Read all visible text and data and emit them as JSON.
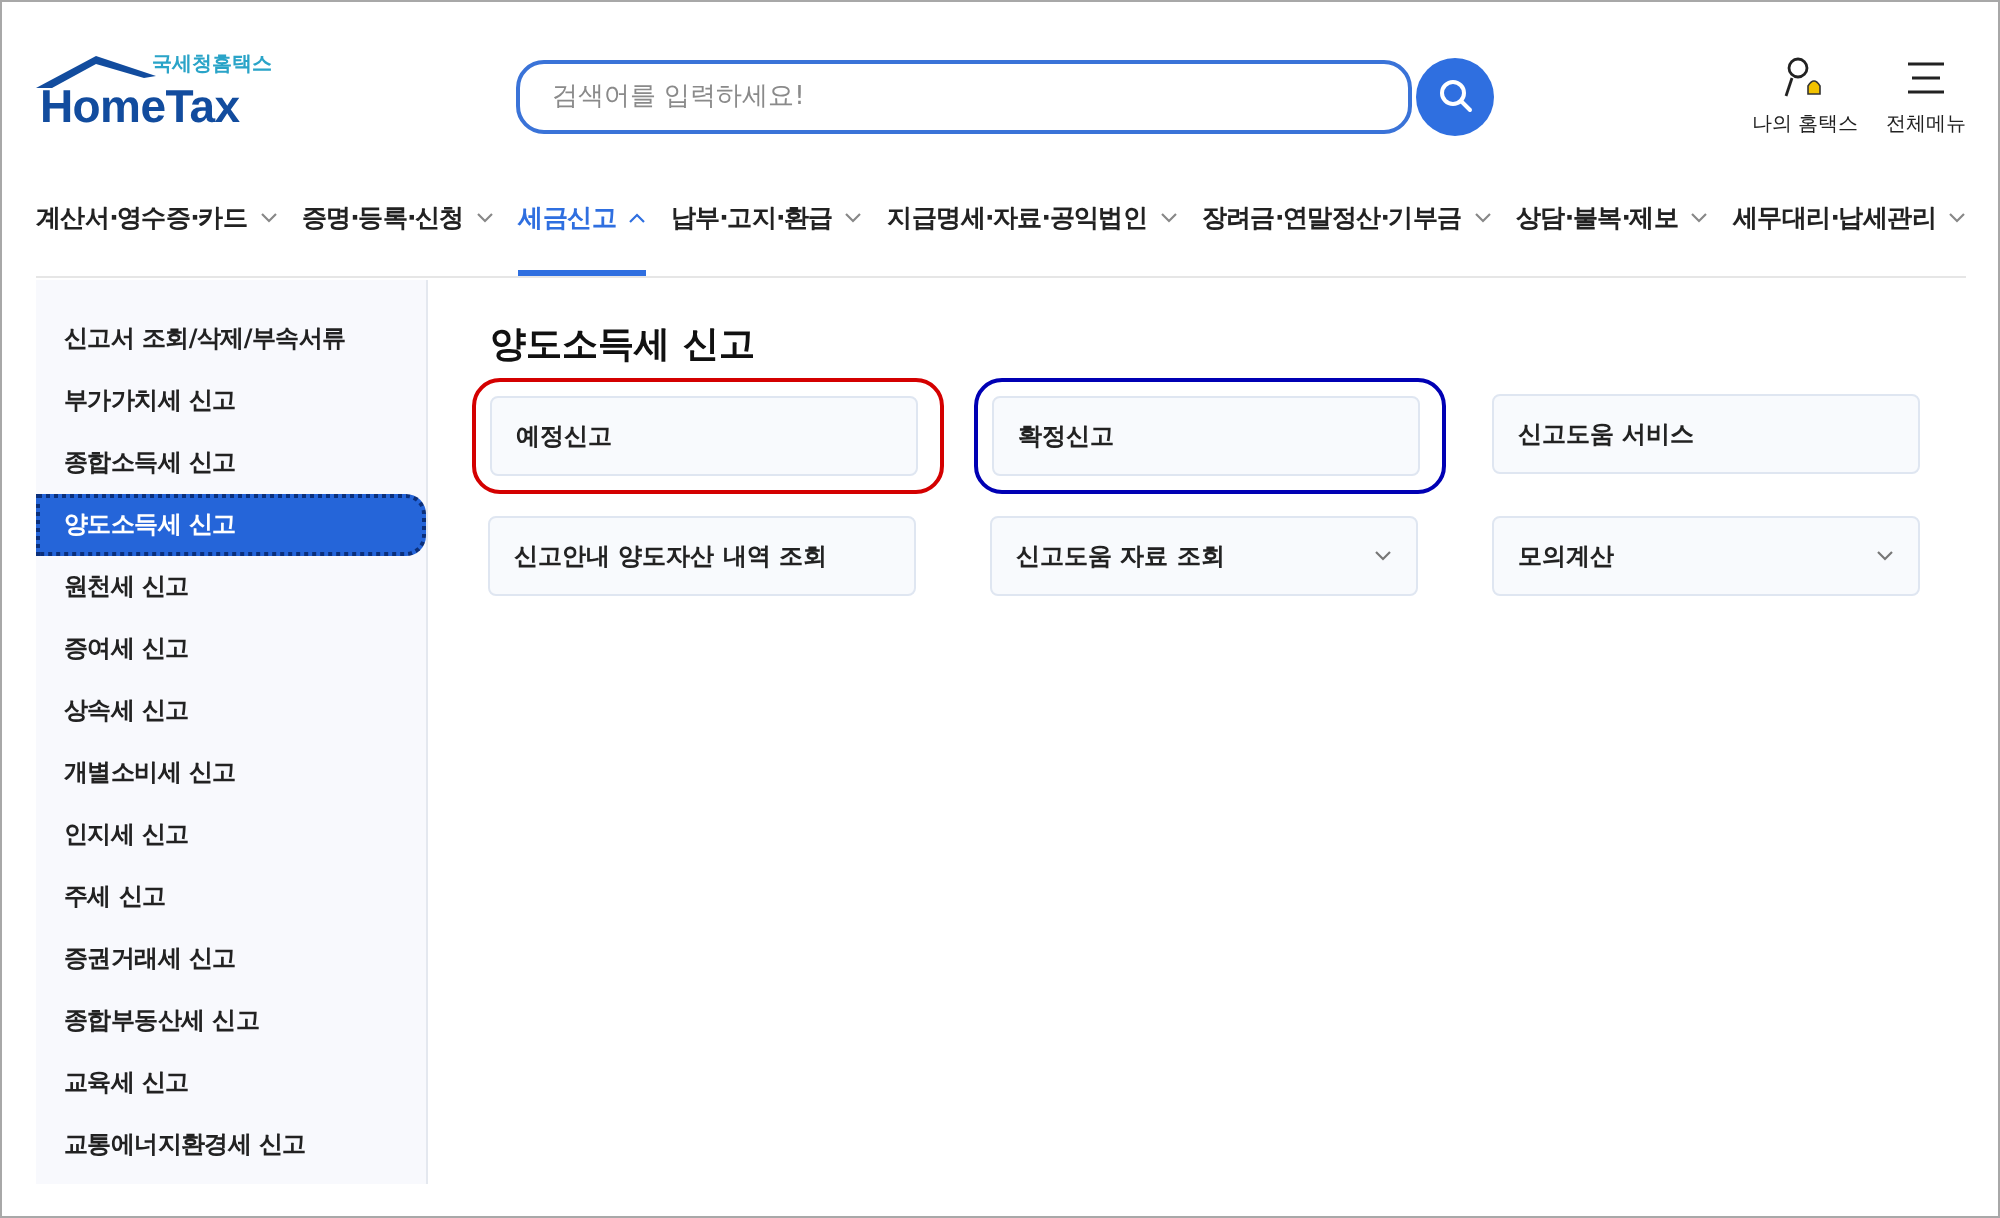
{
  "logo": {
    "subtitle": "국세청홈택스",
    "title": "HomeTax"
  },
  "search": {
    "placeholder": "검색어를 입력하세요!"
  },
  "header_links": [
    {
      "label": "나의 홈택스",
      "kind": "user"
    },
    {
      "label": "전체메뉴",
      "kind": "menu"
    }
  ],
  "nav": [
    {
      "label": "계산서·영수증·카드",
      "selected": false
    },
    {
      "label": "증명·등록·신청",
      "selected": false
    },
    {
      "label": "세금신고",
      "selected": true
    },
    {
      "label": "납부·고지·환급",
      "selected": false
    },
    {
      "label": "지급명세·자료·공익법인",
      "selected": false
    },
    {
      "label": "장려금·연말정산·기부금",
      "selected": false
    },
    {
      "label": "상담·불복·제보",
      "selected": false
    },
    {
      "label": "세무대리·납세관리",
      "selected": false
    }
  ],
  "sidebar": {
    "items": [
      {
        "label": "신고서 조회/삭제/부속서류",
        "selected": false
      },
      {
        "label": "부가가치세 신고",
        "selected": false
      },
      {
        "label": "종합소득세 신고",
        "selected": false
      },
      {
        "label": "양도소득세 신고",
        "selected": true
      },
      {
        "label": "원천세 신고",
        "selected": false
      },
      {
        "label": "증여세 신고",
        "selected": false
      },
      {
        "label": "상속세 신고",
        "selected": false
      },
      {
        "label": "개별소비세 신고",
        "selected": false
      },
      {
        "label": "인지세 신고",
        "selected": false
      },
      {
        "label": "주세 신고",
        "selected": false
      },
      {
        "label": "증권거래세 신고",
        "selected": false
      },
      {
        "label": "종합부동산세 신고",
        "selected": false
      },
      {
        "label": "교육세 신고",
        "selected": false
      },
      {
        "label": "교통에너지환경세 신고",
        "selected": false
      }
    ]
  },
  "content": {
    "title": "양도소득세 신고",
    "cards": [
      {
        "label": "예정신고",
        "expandable": false,
        "color": "#d40000"
      },
      {
        "label": "확정신고",
        "expandable": false,
        "color": "#0000b4"
      },
      {
        "label": "신고도움 서비스",
        "expandable": false
      },
      {
        "label": "신고안내 양도자산 내역 조회",
        "expandable": false
      },
      {
        "label": "신고도움 자료 조회",
        "expandable": true
      },
      {
        "label": "모의계산",
        "expandable": true
      }
    ]
  }
}
